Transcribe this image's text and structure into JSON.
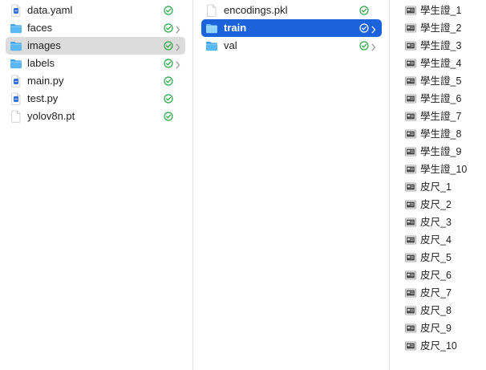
{
  "window": {
    "view": "Finder column view"
  },
  "columns": [
    {
      "id": "root",
      "items": [
        {
          "name": "data.yaml",
          "kind": "yaml-file",
          "synced": true,
          "folder": false,
          "selected": ""
        },
        {
          "name": "faces",
          "kind": "folder",
          "synced": true,
          "folder": true,
          "selected": ""
        },
        {
          "name": "images",
          "kind": "folder",
          "synced": true,
          "folder": true,
          "selected": "gray"
        },
        {
          "name": "labels",
          "kind": "folder",
          "synced": true,
          "folder": true,
          "selected": ""
        },
        {
          "name": "main.py",
          "kind": "python-file",
          "synced": true,
          "folder": false,
          "selected": ""
        },
        {
          "name": "test.py",
          "kind": "python-file",
          "synced": true,
          "folder": false,
          "selected": ""
        },
        {
          "name": "yolov8n.pt",
          "kind": "document-file",
          "synced": true,
          "folder": false,
          "selected": ""
        }
      ]
    },
    {
      "id": "images",
      "items": [
        {
          "name": "encodings.pkl",
          "kind": "document-file",
          "synced": true,
          "folder": false,
          "selected": ""
        },
        {
          "name": "train",
          "kind": "folder",
          "synced": true,
          "folder": true,
          "selected": "blue"
        },
        {
          "name": "val",
          "kind": "folder",
          "synced": true,
          "folder": true,
          "selected": ""
        }
      ]
    },
    {
      "id": "train",
      "items": [
        {
          "name": "學生證_1",
          "kind": "image-file"
        },
        {
          "name": "學生證_2",
          "kind": "image-file"
        },
        {
          "name": "學生證_3",
          "kind": "image-file"
        },
        {
          "name": "學生證_4",
          "kind": "image-file"
        },
        {
          "name": "學生證_5",
          "kind": "image-file"
        },
        {
          "name": "學生證_6",
          "kind": "image-file"
        },
        {
          "name": "學生證_7",
          "kind": "image-file"
        },
        {
          "name": "學生證_8",
          "kind": "image-file"
        },
        {
          "name": "學生證_9",
          "kind": "image-file"
        },
        {
          "name": "學生證_10",
          "kind": "image-file"
        },
        {
          "name": "皮尺_1",
          "kind": "image-file"
        },
        {
          "name": "皮尺_2",
          "kind": "image-file"
        },
        {
          "name": "皮尺_3",
          "kind": "image-file"
        },
        {
          "name": "皮尺_4",
          "kind": "image-file"
        },
        {
          "name": "皮尺_5",
          "kind": "image-file"
        },
        {
          "name": "皮尺_6",
          "kind": "image-file"
        },
        {
          "name": "皮尺_7",
          "kind": "image-file"
        },
        {
          "name": "皮尺_8",
          "kind": "image-file"
        },
        {
          "name": "皮尺_9",
          "kind": "image-file"
        },
        {
          "name": "皮尺_10",
          "kind": "image-file"
        }
      ]
    }
  ],
  "colors": {
    "selection_blue": "#1a63db",
    "selection_gray": "#dcdcdc",
    "folder": "#5ab8f5",
    "sync_green": "#2ba845",
    "separator": "#e3e3e3"
  }
}
